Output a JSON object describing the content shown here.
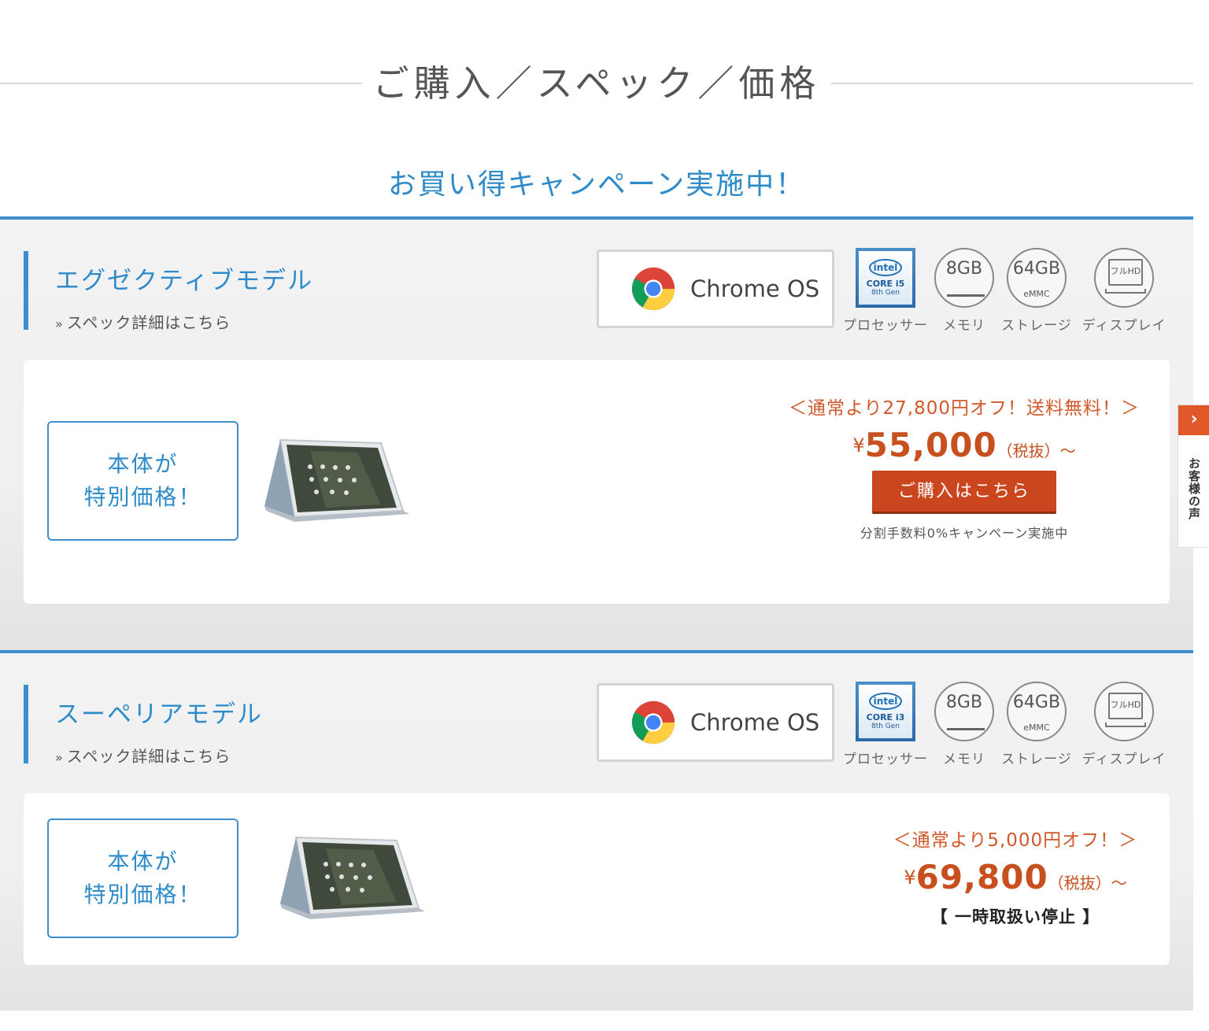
{
  "heading": "ご購入／スペック／価格",
  "campaign": "お買い得キャンペーン実施中！",
  "side_tab": {
    "label": "お客様の声",
    "arrow": "›"
  },
  "models": [
    {
      "title": "エグゼクティブモデル",
      "spec_link": "スペック詳細はこちら",
      "os": "Chrome OS",
      "specs": {
        "cpu": {
          "core": "CORE i5",
          "gen": "8th Gen",
          "label": "プロセッサー"
        },
        "memory": {
          "value": "8GB",
          "label": "メモリ"
        },
        "storage": {
          "value": "64GB",
          "sub": "eMMC",
          "label": "ストレージ"
        },
        "display": {
          "value": "フルHD",
          "label": "ディスプレイ"
        }
      },
      "special_line1": "本体が",
      "special_line2": "特別価格！",
      "offer": "＜通常より27,800円オフ！送料無料！＞",
      "yen": "¥",
      "price": "55,000",
      "tax": "（税抜）～",
      "buy_label": "ご購入はこちら",
      "installment": "分割手数料0%キャンペーン実施中"
    },
    {
      "title": "スーペリアモデル",
      "spec_link": "スペック詳細はこちら",
      "os": "Chrome OS",
      "specs": {
        "cpu": {
          "core": "CORE i3",
          "gen": "8th Gen",
          "label": "プロセッサー"
        },
        "memory": {
          "value": "8GB",
          "label": "メモリ"
        },
        "storage": {
          "value": "64GB",
          "sub": "eMMC",
          "label": "ストレージ"
        },
        "display": {
          "value": "フルHD",
          "label": "ディスプレイ"
        }
      },
      "special_line1": "本体が",
      "special_line2": "特別価格！",
      "offer": "＜通常より5,000円オフ！＞",
      "yen": "¥",
      "price": "69,800",
      "tax": "（税抜）～",
      "status": "【 一時取扱い停止 】"
    }
  ],
  "intel_logo": "intel",
  "colors": {
    "accent_blue": "#3b8fd0",
    "price_orange": "#c8501e",
    "button": "#c9461f"
  }
}
